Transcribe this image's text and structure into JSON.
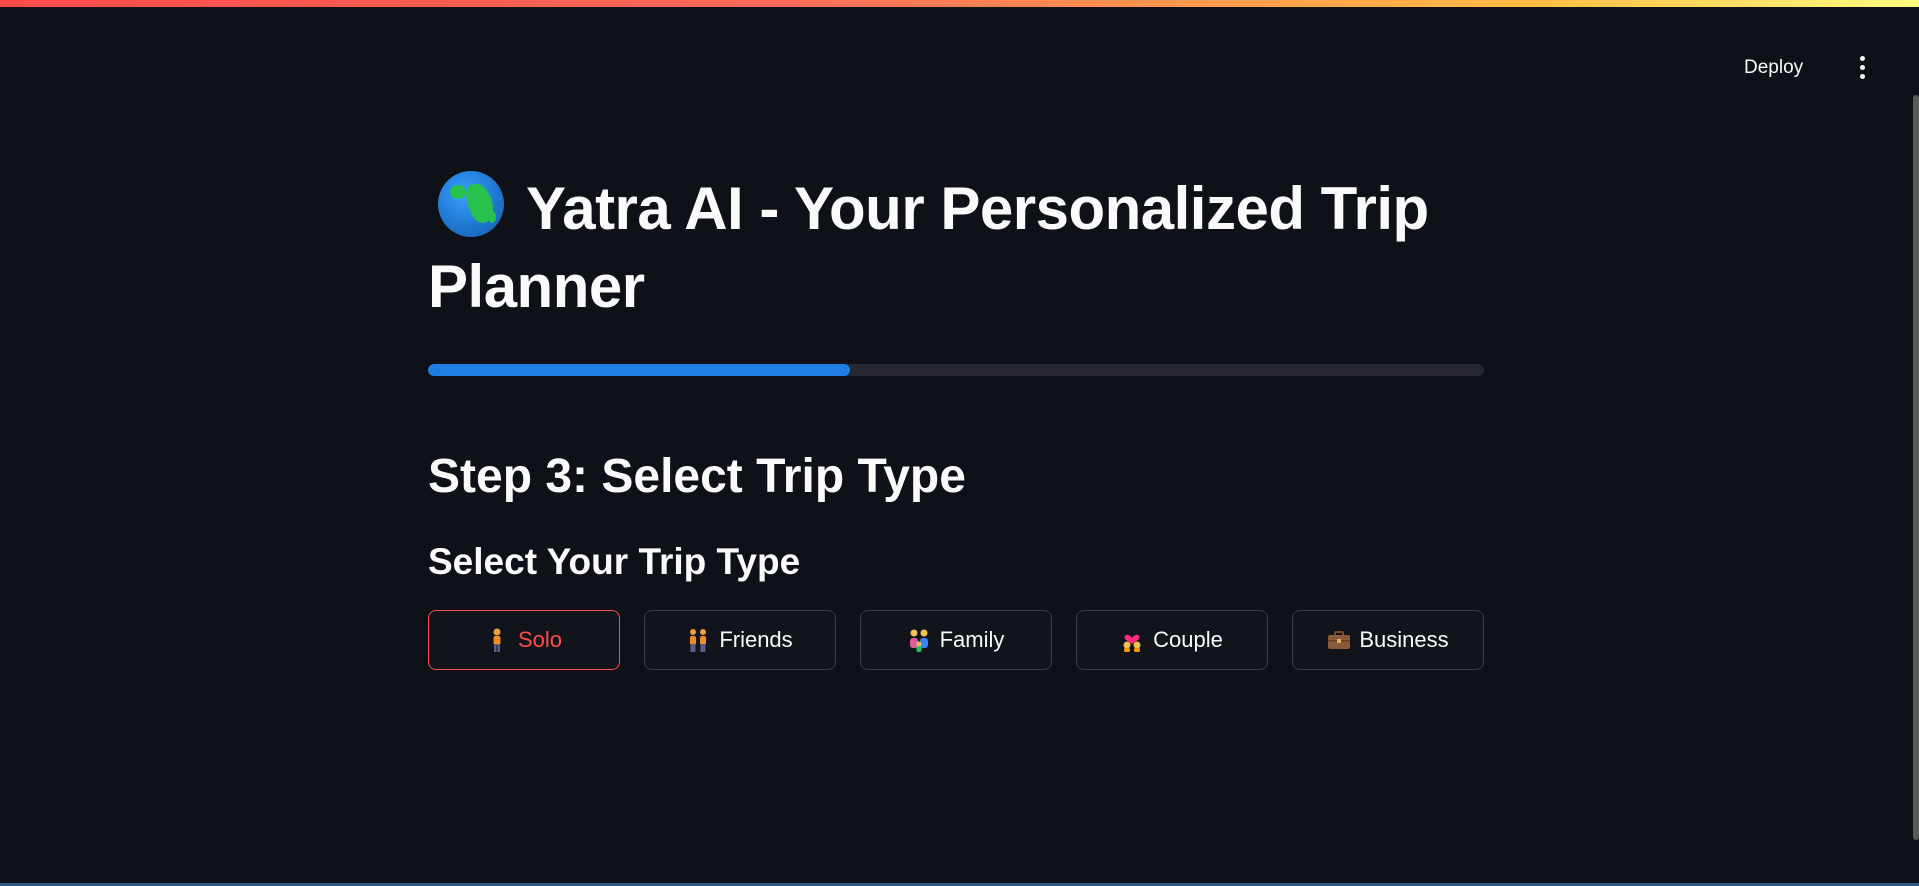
{
  "header": {
    "deploy_label": "Deploy",
    "menu_icon": "vertical-ellipsis-icon"
  },
  "main": {
    "title_icon": "globe-icon",
    "title": "Yatra AI - Your Personalized Trip Planner",
    "progress": 0.4,
    "step_heading": "Step 3: Select Trip Type",
    "sub_heading": "Select Your Trip Type",
    "options": [
      {
        "label": "Solo",
        "icon": "person-icon",
        "selected": true
      },
      {
        "label": "Friends",
        "icon": "two-people-icon",
        "selected": false
      },
      {
        "label": "Family",
        "icon": "family-icon",
        "selected": false
      },
      {
        "label": "Couple",
        "icon": "couple-heart-icon",
        "selected": false
      },
      {
        "label": "Business",
        "icon": "briefcase-icon",
        "selected": false
      }
    ]
  },
  "colors": {
    "background": "#0e1117",
    "accent_selected": "#ff4b4b",
    "progress_fill": "#1f7ee3",
    "progress_track": "#262730"
  }
}
